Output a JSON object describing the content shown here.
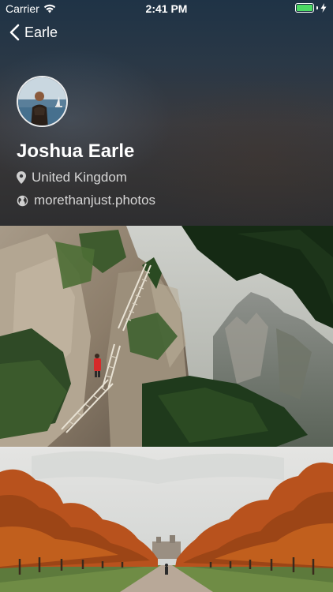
{
  "status_bar": {
    "carrier": "Carrier",
    "time": "2:41 PM",
    "battery_level": 1.0,
    "battery_color": "#4cd964"
  },
  "nav": {
    "back_label": "Earle",
    "back_icon": "chevron-left-icon"
  },
  "profile": {
    "name": "Joshua Earle",
    "location": "United Kingdom",
    "location_icon": "location-pin-icon",
    "website": "morethanjust.photos",
    "website_icon": "globe-icon"
  },
  "photos": [
    {
      "subject": "cliffside wooden staircase with pine trees and mountains"
    },
    {
      "subject": "tree-lined avenue with autumn foliage and a distant castle"
    }
  ]
}
